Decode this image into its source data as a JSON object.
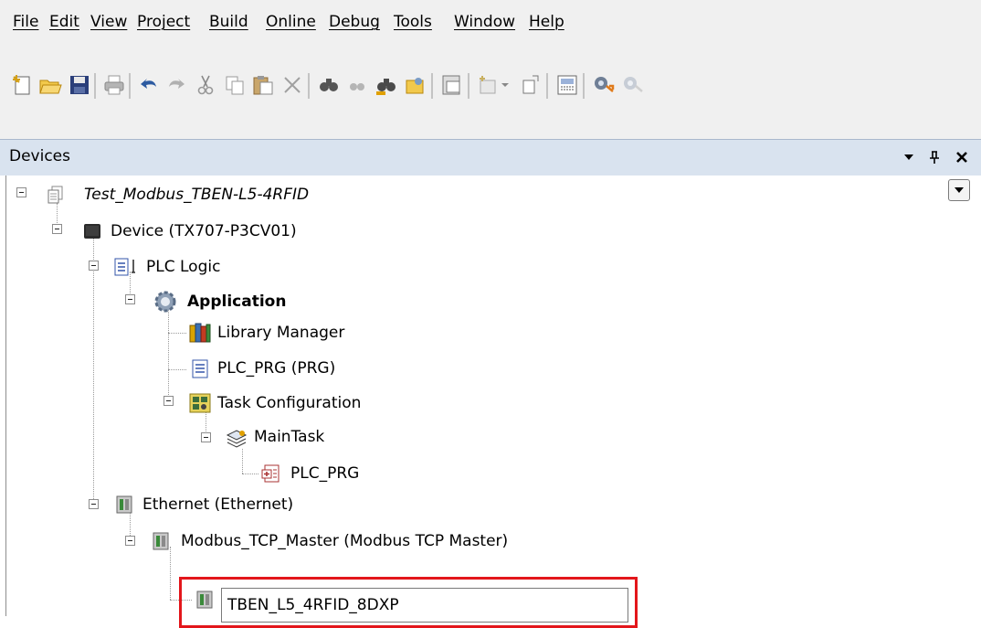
{
  "menu": {
    "items": [
      {
        "id": "file",
        "label": "File"
      },
      {
        "id": "edit",
        "label": "Edit"
      },
      {
        "id": "view",
        "label": "View"
      },
      {
        "id": "project",
        "label": "Project"
      },
      {
        "id": "build",
        "label": "Build"
      },
      {
        "id": "online",
        "label": "Online"
      },
      {
        "id": "debug",
        "label": "Debug"
      },
      {
        "id": "tools",
        "label": "Tools"
      },
      {
        "id": "window",
        "label": "Window"
      },
      {
        "id": "help",
        "label": "Help"
      }
    ]
  },
  "toolbar": {
    "icons": [
      "new-project-icon",
      "open-folder-icon",
      "save-icon",
      "print-icon",
      "undo-icon",
      "redo-icon",
      "cut-icon",
      "copy-icon",
      "paste-icon",
      "delete-icon",
      "find-icon",
      "find-next-icon",
      "replace-icon",
      "replace-all-icon",
      "bookmarks-icon",
      "add-object-icon",
      "add-device-icon",
      "visualization-icon",
      "login-icon",
      "logout-icon"
    ]
  },
  "panel": {
    "title": "Devices"
  },
  "tree": {
    "project": "Test_Modbus_TBEN-L5-4RFID",
    "device": "Device (TX707-P3CV01)",
    "plc_logic": "PLC Logic",
    "application": "Application",
    "library_manager": "Library Manager",
    "plc_prg": "PLC_PRG (PRG)",
    "task_configuration": "Task Configuration",
    "main_task": "MainTask",
    "main_task_call": "PLC_PRG",
    "ethernet": "Ethernet (Ethernet)",
    "modbus_master": "Modbus_TCP_Master (Modbus TCP Master)",
    "rename_value": "TBEN_L5_4RFID_8DXP"
  },
  "colors": {
    "highlight": "#e3161b",
    "panel_header": "#d9e3ef",
    "chrome": "#f0f0f0"
  }
}
